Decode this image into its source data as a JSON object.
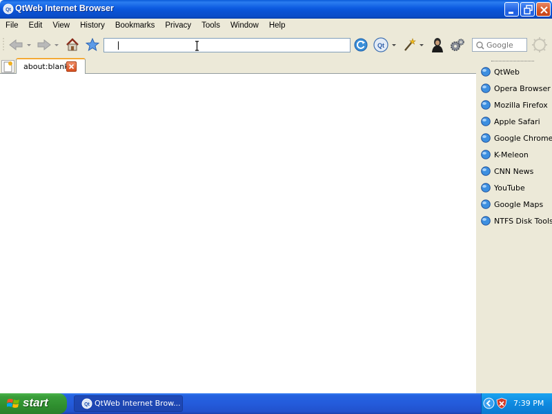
{
  "window": {
    "title": "QtWeb Internet Browser",
    "app_icon": "qtweb-logo-icon",
    "controls": [
      "minimize-icon",
      "maximize-icon",
      "close-icon"
    ]
  },
  "menubar": {
    "items": [
      {
        "label": "File"
      },
      {
        "label": "Edit"
      },
      {
        "label": "View"
      },
      {
        "label": "History"
      },
      {
        "label": "Bookmarks"
      },
      {
        "label": "Privacy"
      },
      {
        "label": "Tools"
      },
      {
        "label": "Window"
      },
      {
        "label": "Help"
      }
    ]
  },
  "toolbar": {
    "buttons": [
      "back-icon",
      "forward-icon",
      "home-icon",
      "bookmark-star-icon",
      "reload-icon",
      "qtweb-menu-icon",
      "magic-wand-icon",
      "privacy-user-icon",
      "settings-gears-icon",
      "activity-spinner-icon"
    ],
    "address": {
      "value": "",
      "placeholder": ""
    },
    "search": {
      "placeholder": "Google",
      "value": ""
    }
  },
  "tabs": [
    {
      "label": "about:blank",
      "active": true
    }
  ],
  "sidebar": {
    "bookmarks": [
      {
        "label": "QtWeb"
      },
      {
        "label": "Opera Browser"
      },
      {
        "label": "Mozilla Firefox"
      },
      {
        "label": "Apple Safari"
      },
      {
        "label": "Google Chrome"
      },
      {
        "label": "K-Meleon"
      },
      {
        "label": "CNN News"
      },
      {
        "label": "YouTube"
      },
      {
        "label": "Google Maps"
      },
      {
        "label": "NTFS Disk Tools"
      }
    ]
  },
  "taskbar": {
    "start_label": "start",
    "task": {
      "label": "QtWeb Internet Brow..."
    },
    "clock": "7:39 PM"
  },
  "colors": {
    "titlebar_blue": "#0a52d4",
    "chrome_beige": "#ece9d8",
    "start_green": "#3a9e3a",
    "tab_accent": "#f4a933"
  }
}
